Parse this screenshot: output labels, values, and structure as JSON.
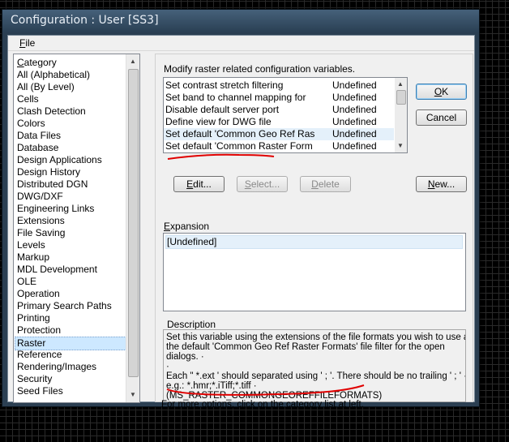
{
  "window": {
    "title": "Configuration : User [SS3]"
  },
  "menu": {
    "file_prefix": "F",
    "file_rest": "ile"
  },
  "category": {
    "header_prefix": "C",
    "header_rest": "ategory",
    "items": [
      "All (Alphabetical)",
      "All (By Level)",
      "Cells",
      "Clash Detection",
      "Colors",
      "Data Files",
      "Database",
      "Design Applications",
      "Design History",
      "Distributed DGN",
      "DWG/DXF",
      "Engineering Links",
      "Extensions",
      "File Saving",
      "Levels",
      "Markup",
      "MDL Development",
      "OLE",
      "Operation",
      "Primary Search Paths",
      "Printing",
      "Protection",
      "Raster",
      "Reference",
      "Rendering/Images",
      "Security",
      "Seed Files"
    ],
    "selected": "Raster"
  },
  "instruction": "Modify raster related configuration variables.",
  "variables": [
    {
      "name": "Set contrast stretch filtering",
      "value": "Undefined"
    },
    {
      "name": "Set band to channel mapping for",
      "value": "Undefined"
    },
    {
      "name": "Disable default server port",
      "value": "Undefined"
    },
    {
      "name": "Define view for DWG file",
      "value": "Undefined"
    },
    {
      "name": "Set default 'Common Geo Ref Ras",
      "value": "Undefined"
    },
    {
      "name": "Set default 'Common Raster Form",
      "value": "Undefined"
    }
  ],
  "buttons": {
    "ok_prefix": "O",
    "ok_rest": "K",
    "cancel": "Cancel",
    "edit_prefix": "E",
    "edit_rest": "dit...",
    "select_prefix": "S",
    "select_rest": "elect...",
    "delete_prefix": "D",
    "delete_rest": "elete",
    "new_prefix": "N",
    "new_rest": "ew..."
  },
  "expansion": {
    "label_prefix": "E",
    "label_rest": "xpansion",
    "value": "[Undefined]"
  },
  "description": {
    "label": "Description",
    "lines": [
      "Set this variable using the extensions of the file formats you wish to use as",
      "the default 'Common Geo Ref Raster Formats' file filter for the open",
      "dialogs. ·",
      "·",
      "Each \" *.ext ' should separated using ' ; '. There should be no trailing ' ; ' ·",
      "e.g.: *.hmr;*.iTiff;*.tiff ·",
      "(MS_RASTER_COMMONGEOREFFILEFORMATS)"
    ]
  },
  "status": "For more options, click on the category list at left.",
  "colors": {
    "selection": "#cde8ff",
    "annotation": "#e00000",
    "titlebar": "#2b3f52"
  }
}
